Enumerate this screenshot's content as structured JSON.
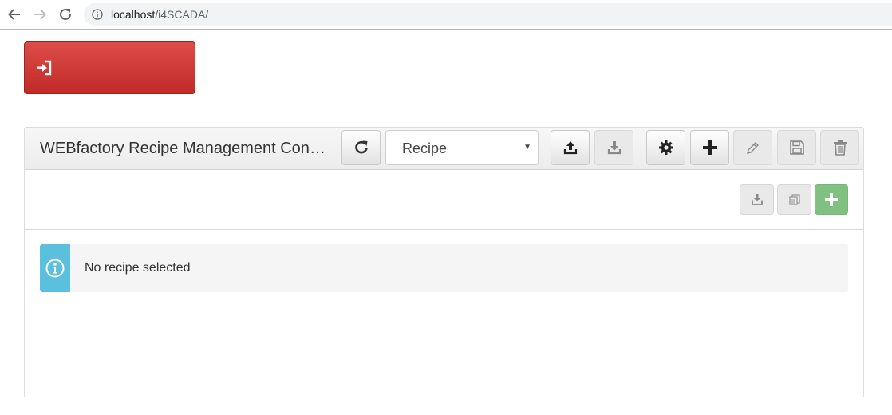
{
  "browser": {
    "url_host": "localhost",
    "url_path": "/i4SCADA/"
  },
  "icons": {
    "back": "arrow-left-icon",
    "forward": "arrow-right-icon",
    "reload": "reload-icon",
    "site_info": "info-circle-icon",
    "login": "sign-in-icon",
    "refresh": "refresh-icon",
    "upload": "upload-icon",
    "download": "download-icon",
    "settings": "gear-icon",
    "add": "plus-icon",
    "edit": "pencil-icon",
    "save": "floppy-disk-icon",
    "delete": "trash-icon",
    "copy": "copy-icon",
    "info": "info-circle-icon"
  },
  "colors": {
    "login_button": "#c9302c",
    "info_accent": "#5bc0de",
    "add_value_button": "#80c080"
  },
  "widget": {
    "title": "WEBfactory Recipe Management Control",
    "selector_value": "Recipe",
    "info_message": "No recipe selected"
  }
}
